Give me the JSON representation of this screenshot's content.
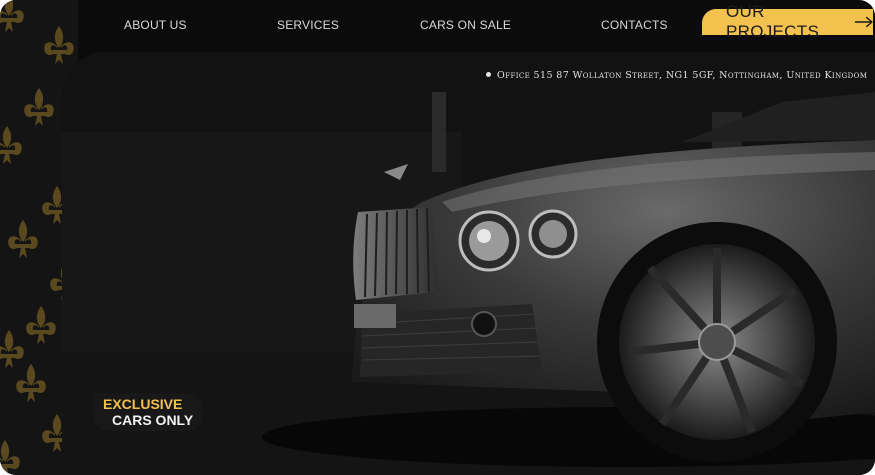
{
  "nav": {
    "items": [
      {
        "label": "ABOUT US"
      },
      {
        "label": "SERVICES"
      },
      {
        "label": "CARS ON SALE"
      },
      {
        "label": "CONTACTS"
      }
    ],
    "cta_label": "OUR PROJECTS"
  },
  "hero": {
    "address": "Office 515 87 Wollaton Street, NG1 5GF, Nottingham, United Kingdom",
    "badge_line1": "EXCLUSIVE",
    "badge_line2": "CARS ONLY"
  },
  "colors": {
    "accent": "#f2c14e",
    "background": "#0b0b0b",
    "nav_text": "#d9d9d9",
    "pattern": "#b08a2e"
  },
  "icons": {
    "cta_arrow": "arrow-right-icon",
    "pattern": "fleur-de-lis-icon",
    "address_bullet": "bullet-dot-icon"
  }
}
